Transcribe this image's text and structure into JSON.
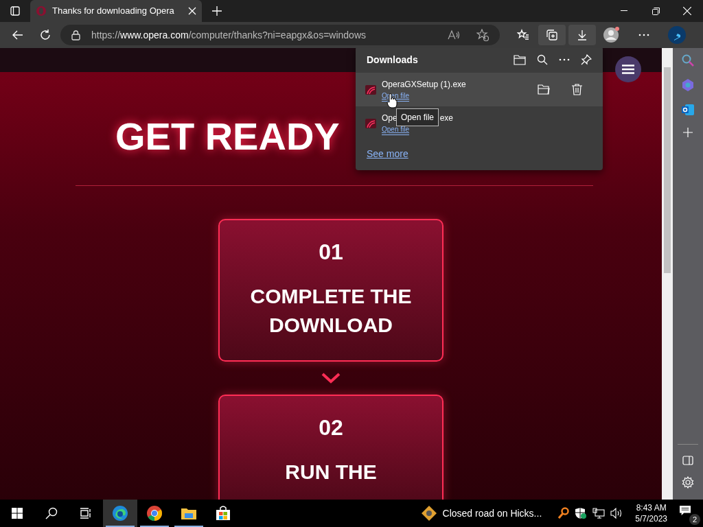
{
  "browser": {
    "tab": {
      "title": "Thanks for downloading Opera",
      "selected": true
    },
    "address": {
      "url_prefix": "https://",
      "url_domain": "www.opera.com",
      "url_path": "/computer/thanks?ni=eapgx&os=windows"
    }
  },
  "page": {
    "heading": "GET READY",
    "steps": [
      {
        "number": "01",
        "title": "COMPLETE THE DOWNLOAD"
      },
      {
        "number": "02",
        "title": "RUN THE"
      }
    ]
  },
  "downloads": {
    "title": "Downloads",
    "items": [
      {
        "name_start": "OperaGXSetup (1).exe",
        "action": "Open file",
        "selected": true
      },
      {
        "name_start": "Ope",
        "name_end": "exe",
        "action": "Open file",
        "selected": false
      }
    ],
    "tooltip": "Open file",
    "see_more": "See more"
  },
  "taskbar": {
    "apps": [
      {
        "kind": "edge",
        "selected": true
      },
      {
        "kind": "chrome",
        "selected": false
      },
      {
        "kind": "explorer",
        "selected": false
      },
      {
        "kind": "store",
        "selected": false
      }
    ],
    "news": "Closed road on Hicks...",
    "time": "8:43 AM",
    "date": "5/7/2023",
    "notifications": "2"
  }
}
